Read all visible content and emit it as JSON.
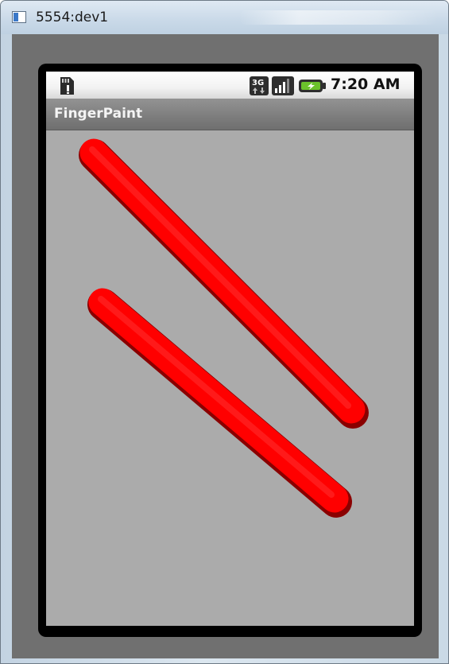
{
  "window": {
    "title": "5554:dev1"
  },
  "status_bar": {
    "icons": [
      "sd-card-icon",
      "3g-data-icon",
      "signal-strength-icon",
      "battery-charging-icon"
    ],
    "network_label": "3G",
    "time": "7:20 AM"
  },
  "app": {
    "title": "FingerPaint"
  },
  "canvas": {
    "background_color": "#ababab",
    "stroke_color": "#ff0000",
    "stroke_count": 2
  }
}
